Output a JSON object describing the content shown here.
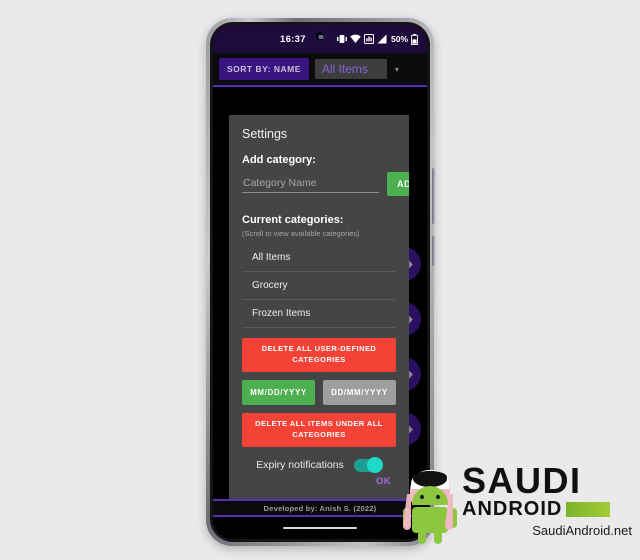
{
  "status_bar": {
    "time": "16:37",
    "battery_percent": "50%",
    "icons": [
      "vibrate-icon",
      "wifi-icon",
      "app-notification-icon",
      "signal-icon",
      "battery-icon"
    ]
  },
  "toolbar": {
    "sort_button_label": "SORT BY: NAME",
    "spinner_value": "All Items",
    "spinner_caret": "▾"
  },
  "dialog": {
    "title": "Settings",
    "add_category_label": "Add category:",
    "category_input_value": "",
    "category_input_placeholder": "Category Name",
    "add_button_label": "ADD",
    "current_categories_label": "Current categories:",
    "current_categories_hint": "(Scroll to view available categories)",
    "categories": [
      "All Items",
      "Grocery",
      "Frozen Items"
    ],
    "delete_user_categories_label": "DELETE ALL USER-DEFINED CATEGORIES",
    "date_formats": [
      {
        "label": "MM/DD/YYYY",
        "selected": true
      },
      {
        "label": "DD/MM/YYYY",
        "selected": false
      }
    ],
    "delete_all_items_label": "DELETE ALL ITEMS UNDER ALL CATEGORIES",
    "expiry_label": "Expiry notifications",
    "expiry_enabled": true,
    "ok_label": "OK"
  },
  "footer": {
    "text": "Developed by: Anish S. (2022)"
  },
  "watermark": {
    "line1": "SAUDI",
    "line2": "ANDROID",
    "url": "SaudiAndroid.net"
  },
  "colors": {
    "status_bar_bg": "#1f0a3c",
    "accent_purple": "#5b2bb0",
    "sort_button_bg": "#3a1480",
    "spinner_text": "#8a62d8",
    "dialog_bg": "#454545",
    "add_green": "#4CAF50",
    "danger_red": "#f44336",
    "unselected_grey": "#9e9e9e",
    "toggle_teal": "#1ddbc8",
    "ok_purple": "#a06ae0"
  }
}
